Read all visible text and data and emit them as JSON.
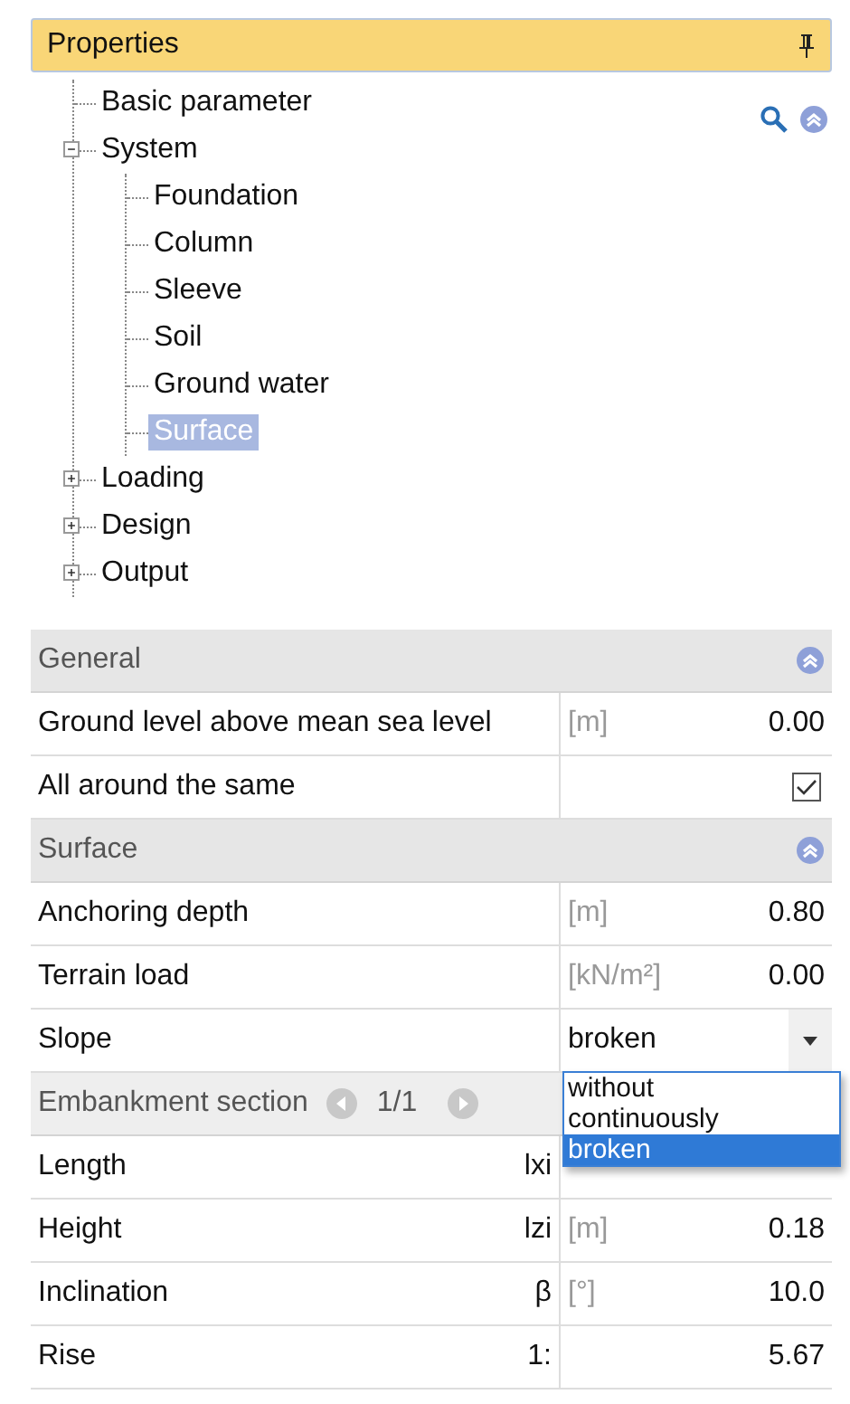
{
  "panel": {
    "title": "Properties"
  },
  "tree": [
    {
      "label": "Basic parameter",
      "selected": false
    },
    {
      "label": "System",
      "selected": false,
      "expanded": true,
      "children": [
        {
          "label": "Foundation",
          "selected": false
        },
        {
          "label": "Column",
          "selected": false
        },
        {
          "label": "Sleeve",
          "selected": false
        },
        {
          "label": "Soil",
          "selected": false
        },
        {
          "label": "Ground water",
          "selected": false
        },
        {
          "label": "Surface",
          "selected": true
        }
      ]
    },
    {
      "label": "Loading",
      "selected": false,
      "expanded": false
    },
    {
      "label": "Design",
      "selected": false,
      "expanded": false
    },
    {
      "label": "Output",
      "selected": false,
      "expanded": false
    }
  ],
  "grid": [
    {
      "kind": "section",
      "label": "General",
      "expanded": true
    },
    {
      "kind": "value",
      "label": "Ground level above mean sea level",
      "unit": "[m]",
      "value": "0.00"
    },
    {
      "kind": "checkbox",
      "label": "All around the same",
      "checked": true
    },
    {
      "kind": "section",
      "label": "Surface",
      "expanded": true
    },
    {
      "kind": "value",
      "label": "Anchoring depth",
      "unit": "[m]",
      "value": "0.80"
    },
    {
      "kind": "value",
      "label": "Terrain load",
      "unit": "[kN/m²]",
      "value": "0.00"
    },
    {
      "kind": "dropdown",
      "label": "Slope",
      "value": "broken",
      "open": true,
      "options": [
        {
          "label": "without",
          "selected": false
        },
        {
          "label": "continuously",
          "selected": false
        },
        {
          "label": "broken",
          "selected": true
        }
      ]
    },
    {
      "kind": "pager",
      "label": "Embankment section",
      "page": "1/1"
    },
    {
      "kind": "value",
      "label": "Length",
      "symbol": "lxi"
    },
    {
      "kind": "value",
      "label": "Height",
      "symbol": "lzi",
      "unit": "[m]",
      "value": "0.18"
    },
    {
      "kind": "value",
      "label": "Inclination",
      "symbol": "β",
      "unit": "[°]",
      "value": "10.0"
    },
    {
      "kind": "value",
      "label": "Rise",
      "symbol": "1:",
      "value": "5.67"
    }
  ]
}
